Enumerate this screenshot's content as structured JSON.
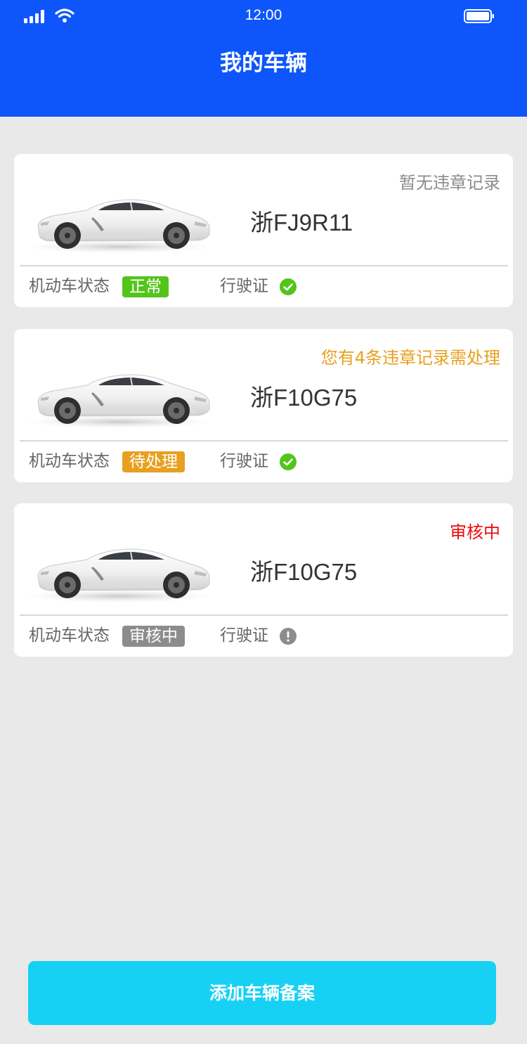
{
  "status_bar": {
    "time": "12:00",
    "signal_icon": "cellular-signal-icon",
    "wifi_icon": "wifi-icon",
    "battery_icon": "battery-icon"
  },
  "header": {
    "title": "我的车辆"
  },
  "vehicles": [
    {
      "plate": "浙FJ9R11",
      "notice": "暂无违章记录",
      "notice_color": "#8c8c8c",
      "status_label": "机动车状态",
      "status_badge": "正常",
      "status_color": "#52c41a",
      "license_label": "行驶证",
      "license_icon": "check-circle-icon",
      "license_icon_color": "#52c41a"
    },
    {
      "plate": "浙F10G75",
      "notice": "您有4条违章记录需处理",
      "notice_color": "#e8a020",
      "status_label": "机动车状态",
      "status_badge": "待处理",
      "status_color": "#e8a020",
      "license_label": "行驶证",
      "license_icon": "check-circle-icon",
      "license_icon_color": "#52c41a"
    },
    {
      "plate": "浙F10G75",
      "notice": "审核中",
      "notice_color": "#ee0a0a",
      "status_label": "机动车状态",
      "status_badge": "审核中",
      "status_color": "#8c8c8c",
      "license_label": "行驶证",
      "license_icon": "exclamation-circle-icon",
      "license_icon_color": "#8c8c8c"
    }
  ],
  "footer": {
    "add_button_label": "添加车辆备案",
    "add_button_color": "#17d1f5"
  },
  "colors": {
    "header_bg": "#0e56fb",
    "page_bg": "#e9e9e9"
  }
}
